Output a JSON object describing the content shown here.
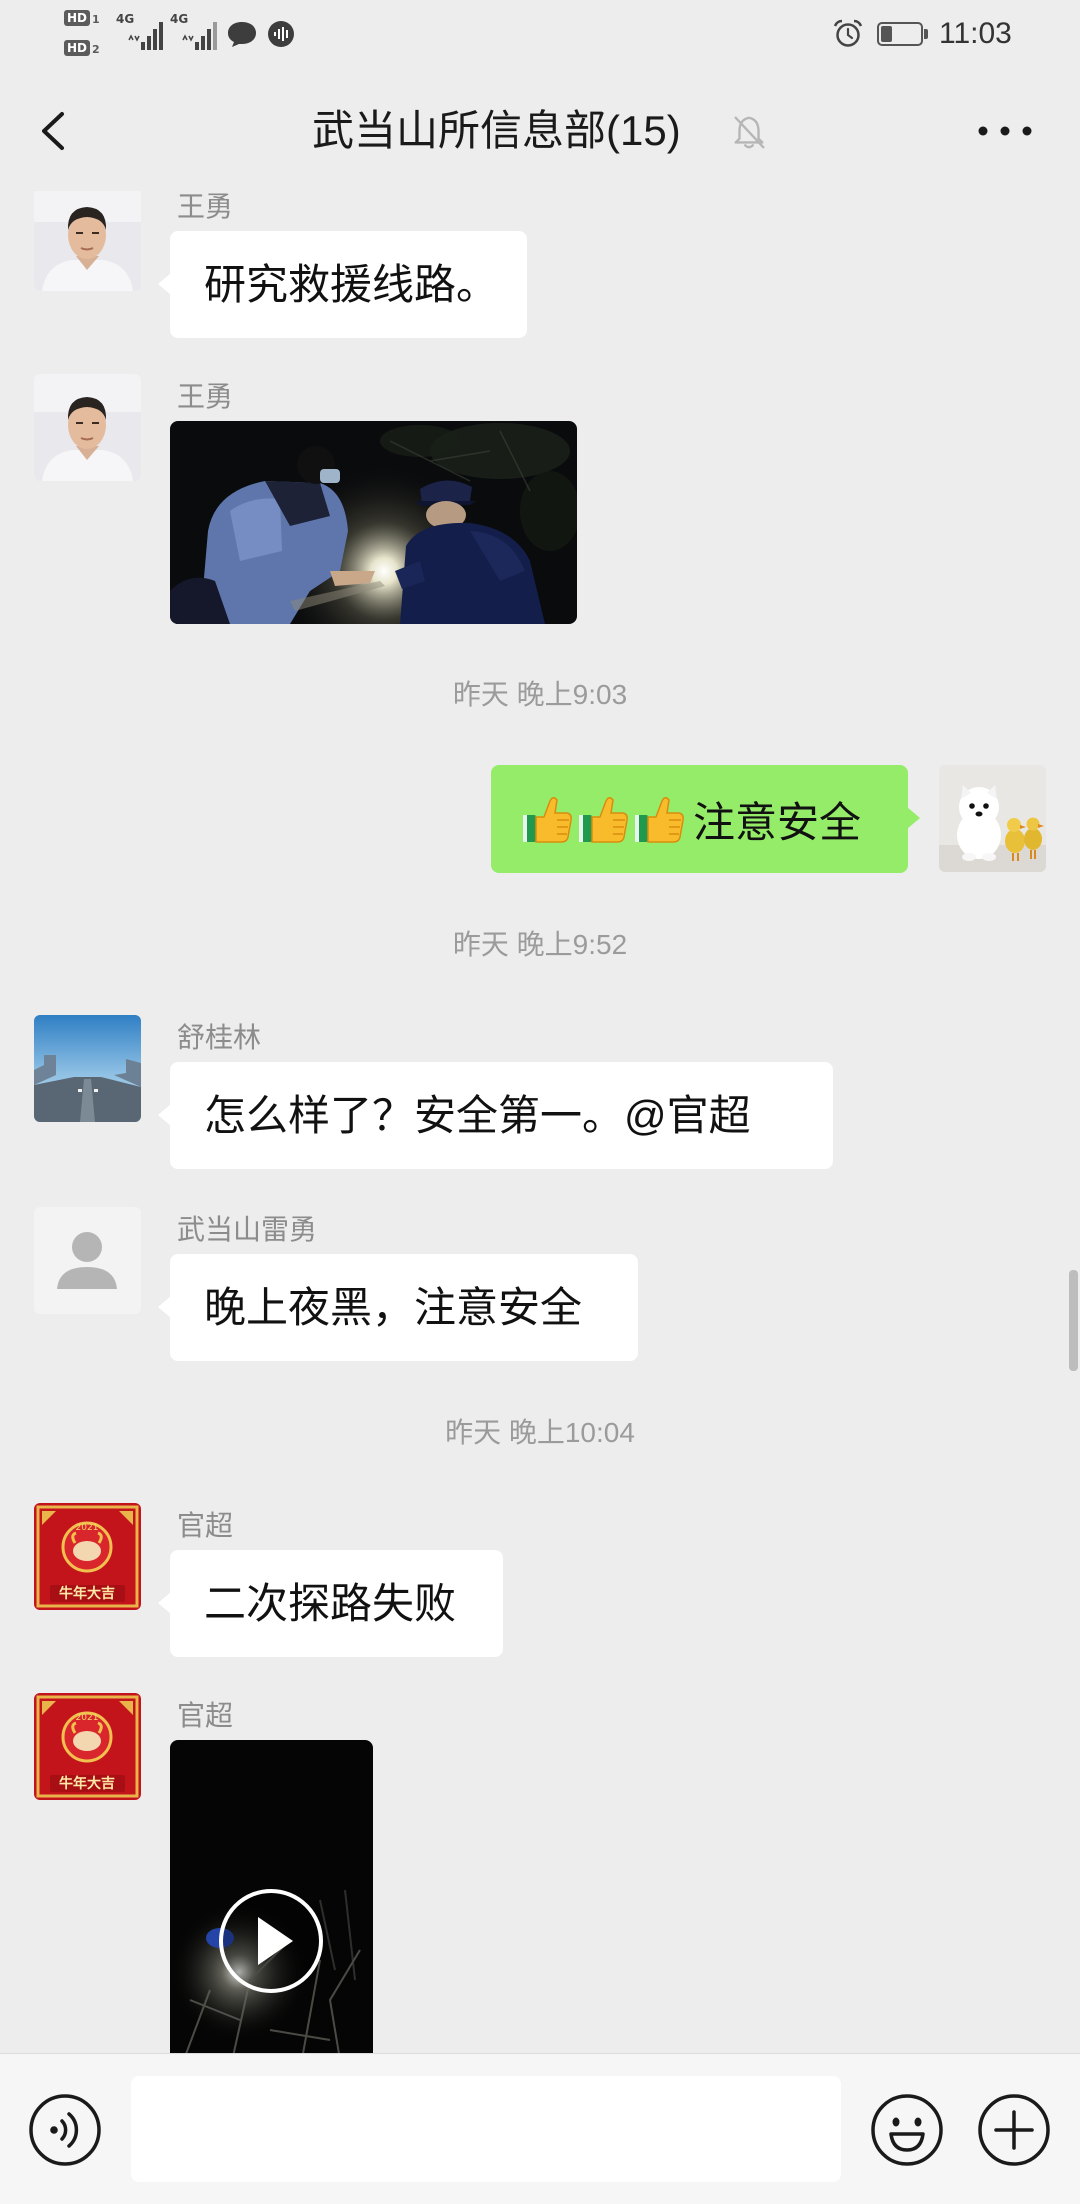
{
  "status_bar": {
    "hd_labels": [
      "HD",
      "HD"
    ],
    "hd_sub": [
      "1",
      "2"
    ],
    "network": [
      "4G",
      "4G"
    ],
    "icons": [
      "signal-icon",
      "signal-icon",
      "message-notification-icon",
      "voice-notification-icon",
      "alarm-icon",
      "battery-icon"
    ],
    "battery_level": 0.3,
    "time": "11:03"
  },
  "header": {
    "back_icon": "chevron-left-icon",
    "title": "武当山所信息部(15)",
    "mute_icon": "bell-off-icon",
    "more_icon": "more-dots-icon"
  },
  "chat": {
    "messages": [
      {
        "sender": "王勇",
        "text": "研究救援线路。"
      },
      {
        "sender": "王勇"
      },
      {
        "time": "昨天 晚上9:03"
      },
      {
        "emoji_icons": [
          "thumbs-up-icon",
          "thumbs-up-icon",
          "thumbs-up-icon"
        ],
        "text": "注意安全"
      },
      {
        "time": "昨天 晚上9:52"
      },
      {
        "sender": "舒桂林",
        "text": "怎么样了？安全第一。@官超"
      },
      {
        "sender": "武当山雷勇",
        "text": "晚上夜黑，注意安全"
      },
      {
        "time": "昨天 晚上10:04"
      },
      {
        "sender": "官超",
        "text": "二次探路失败"
      },
      {
        "sender": "官超",
        "play_icon": "play-icon"
      }
    ]
  },
  "avatar_art": {
    "guanchao_year": "2021",
    "guanchao_greeting": "牛年大吉"
  },
  "input_bar": {
    "voice_icon": "voice-input-icon",
    "input_value": "",
    "emoji_icon": "emoji-icon",
    "plus_icon": "plus-icon"
  },
  "colors": {
    "background": "#ededed",
    "bubble_other": "#ffffff",
    "bubble_self": "#95ec69",
    "timestamp": "#9b9b9b",
    "sender_name": "#8c8c8c"
  }
}
